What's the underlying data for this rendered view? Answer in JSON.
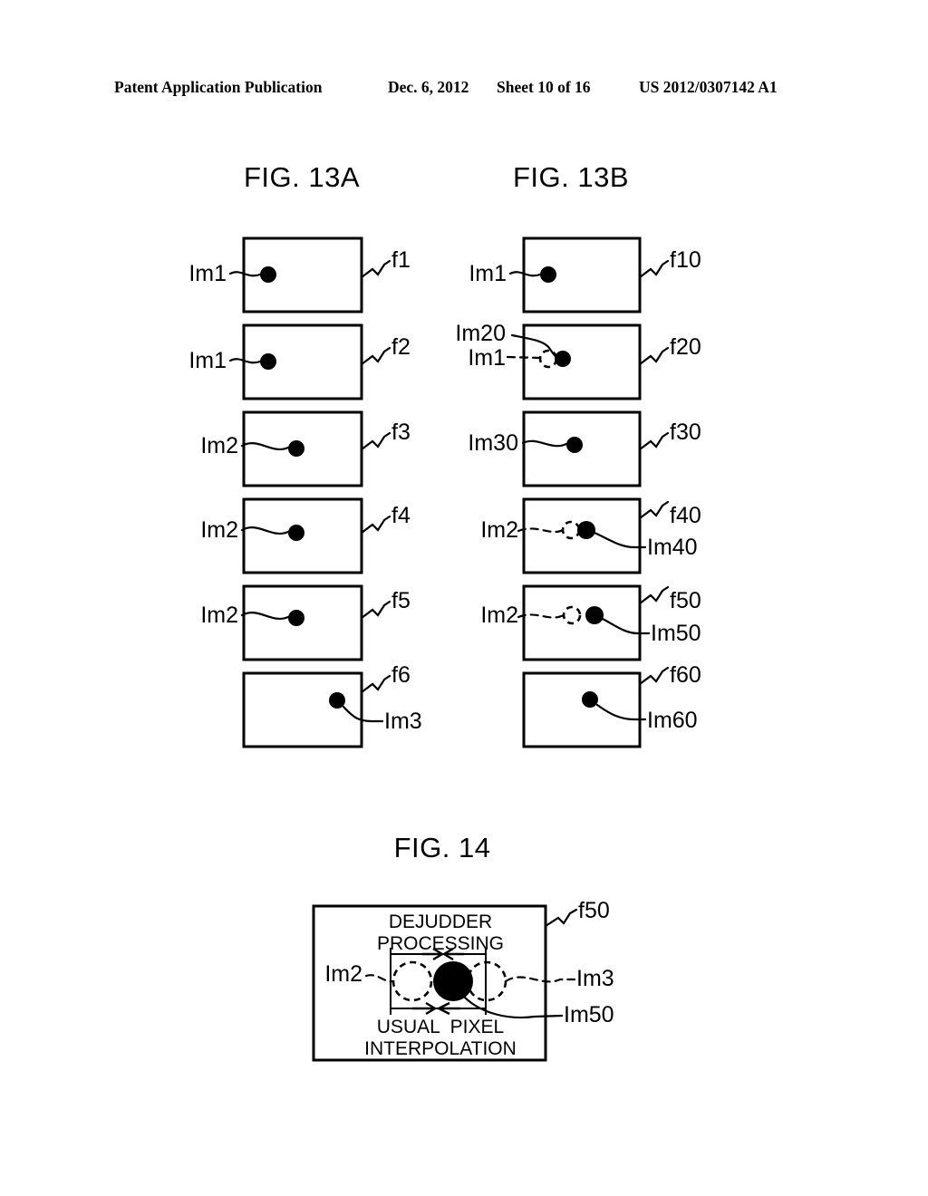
{
  "header": {
    "publication": "Patent Application Publication",
    "date": "Dec. 6, 2012",
    "sheet": "Sheet 10 of 16",
    "number": "US 2012/0307142 A1"
  },
  "figures": [
    {
      "title": "FIG. 13A",
      "frames": [
        {
          "frame_label": "f1",
          "left_label": "Im1",
          "right_label": ""
        },
        {
          "frame_label": "f2",
          "left_label": "Im1",
          "right_label": ""
        },
        {
          "frame_label": "f3",
          "left_label": "Im2",
          "right_label": ""
        },
        {
          "frame_label": "f4",
          "left_label": "Im2",
          "right_label": ""
        },
        {
          "frame_label": "f5",
          "left_label": "Im2",
          "right_label": ""
        },
        {
          "frame_label": "f6",
          "left_label": "",
          "right_label": "Im3"
        }
      ]
    },
    {
      "title": "FIG. 13B",
      "frames": [
        {
          "frame_label": "f10",
          "left_label": "Im1",
          "left_label_2": "",
          "right_label": ""
        },
        {
          "frame_label": "f20",
          "left_label": "Im20",
          "left_label_2": "Im1",
          "right_label": ""
        },
        {
          "frame_label": "f30",
          "left_label": "Im30",
          "left_label_2": "",
          "right_label": ""
        },
        {
          "frame_label": "f40",
          "left_label": "Im2",
          "left_label_2": "",
          "right_label": "Im40"
        },
        {
          "frame_label": "f50",
          "left_label": "Im2",
          "left_label_2": "",
          "right_label": "Im50"
        },
        {
          "frame_label": "f60",
          "left_label": "",
          "left_label_2": "",
          "right_label": "Im60"
        }
      ]
    }
  ],
  "fig14": {
    "title": "FIG. 14",
    "frame_label": "f50",
    "caption_top_line1": "DEJUDDER",
    "caption_top_line2": "PROCESSING",
    "caption_bottom_line1": "USUAL  PIXEL",
    "caption_bottom_line2": "INTERPOLATION",
    "label_left": "Im2",
    "label_right_1": "Im3",
    "label_right_2": "Im50"
  },
  "colors": {
    "ink": "#000000",
    "paper": "#ffffff"
  }
}
